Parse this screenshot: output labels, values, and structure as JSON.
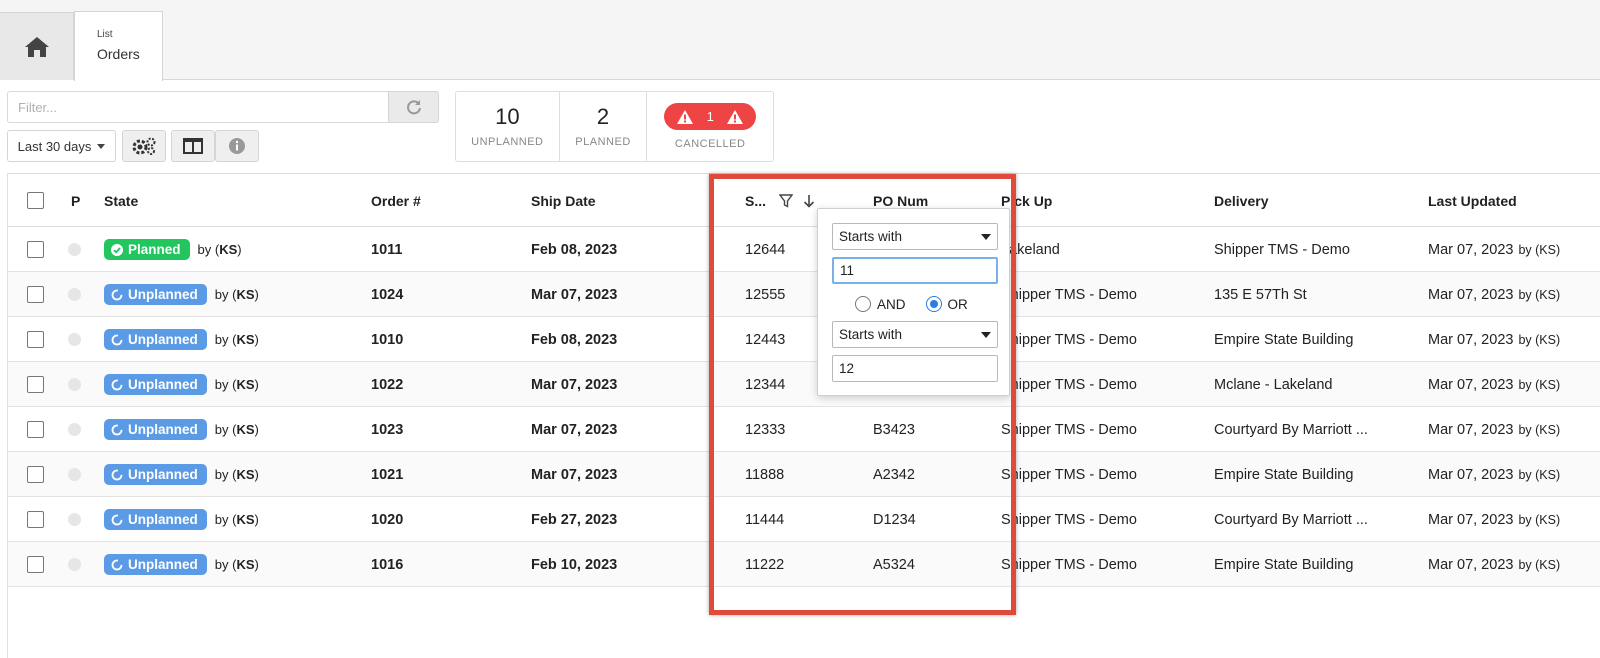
{
  "tabs": {
    "home_icon": "home-icon",
    "orders_small": "List",
    "orders_label": "Orders"
  },
  "filter": {
    "placeholder": "Filter...",
    "value": "",
    "refresh_icon": "refresh-icon"
  },
  "toolbar": {
    "date_range": "Last 30 days",
    "settings_icon": "gears-icon",
    "columns_icon": "columns-icon",
    "info_icon": "info-icon"
  },
  "counts": {
    "unplanned_num": "10",
    "unplanned_label": "UNPLANNED",
    "planned_num": "2",
    "planned_label": "PLANNED",
    "cancelled_num": "1",
    "cancelled_label": "CANCELLED",
    "cancelled_color": "#ef4444"
  },
  "table": {
    "headers": {
      "p": "P",
      "state": "State",
      "order": "Order #",
      "ship_date": "Ship Date",
      "shipment": "S...",
      "po_num": "PO Num",
      "pick_up": "Pick Up",
      "delivery": "Delivery",
      "last_updated": "Last Updated"
    },
    "rows": [
      {
        "state": "Planned",
        "by": "by",
        "user": "KS",
        "order": "1011",
        "ship": "Feb 08, 2023",
        "s": "12644",
        "po": "",
        "pickup": "Lakeland",
        "delivery": "Shipper TMS - Demo",
        "updated": "Mar 07, 2023",
        "upd_by": "by",
        "upd_user": "KS"
      },
      {
        "state": "Unplanned",
        "by": "by",
        "user": "KS",
        "order": "1024",
        "ship": "Mar 07, 2023",
        "s": "12555",
        "po": "",
        "pickup": "Shipper TMS - Demo",
        "delivery": "135 E 57Th St",
        "updated": "Mar 07, 2023",
        "upd_by": "by",
        "upd_user": "KS"
      },
      {
        "state": "Unplanned",
        "by": "by",
        "user": "KS",
        "order": "1010",
        "ship": "Feb 08, 2023",
        "s": "12443",
        "po": "",
        "pickup": "Shipper TMS - Demo",
        "delivery": "Empire State Building",
        "updated": "Mar 07, 2023",
        "upd_by": "by",
        "upd_user": "KS"
      },
      {
        "state": "Unplanned",
        "by": "by",
        "user": "KS",
        "order": "1022",
        "ship": "Mar 07, 2023",
        "s": "12344",
        "po": "",
        "pickup": "Shipper TMS - Demo",
        "delivery": "Mclane - Lakeland",
        "updated": "Mar 07, 2023",
        "upd_by": "by",
        "upd_user": "KS"
      },
      {
        "state": "Unplanned",
        "by": "by",
        "user": "KS",
        "order": "1023",
        "ship": "Mar 07, 2023",
        "s": "12333",
        "po": "B3423",
        "pickup": "Shipper TMS - Demo",
        "delivery": "Courtyard By Marriott ...",
        "updated": "Mar 07, 2023",
        "upd_by": "by",
        "upd_user": "KS"
      },
      {
        "state": "Unplanned",
        "by": "by",
        "user": "KS",
        "order": "1021",
        "ship": "Mar 07, 2023",
        "s": "11888",
        "po": "A2342",
        "pickup": "Shipper TMS - Demo",
        "delivery": "Empire State Building",
        "updated": "Mar 07, 2023",
        "upd_by": "by",
        "upd_user": "KS"
      },
      {
        "state": "Unplanned",
        "by": "by",
        "user": "KS",
        "order": "1020",
        "ship": "Feb 27, 2023",
        "s": "11444",
        "po": "D1234",
        "pickup": "Shipper TMS - Demo",
        "delivery": "Courtyard By Marriott ...",
        "updated": "Mar 07, 2023",
        "upd_by": "by",
        "upd_user": "KS"
      },
      {
        "state": "Unplanned",
        "by": "by",
        "user": "KS",
        "order": "1016",
        "ship": "Feb 10, 2023",
        "s": "11222",
        "po": "A5324",
        "pickup": "Shipper TMS - Demo",
        "delivery": "Empire State Building",
        "updated": "Mar 07, 2023",
        "upd_by": "by",
        "upd_user": "KS"
      }
    ]
  },
  "popup": {
    "op1": "Starts with",
    "val1": "11",
    "and_label": "AND",
    "or_label": "OR",
    "op2": "Starts with",
    "val2": "12"
  },
  "colors": {
    "planned": "#22c55e",
    "unplanned": "#5b9be6",
    "highlight": "#e04a3a"
  }
}
